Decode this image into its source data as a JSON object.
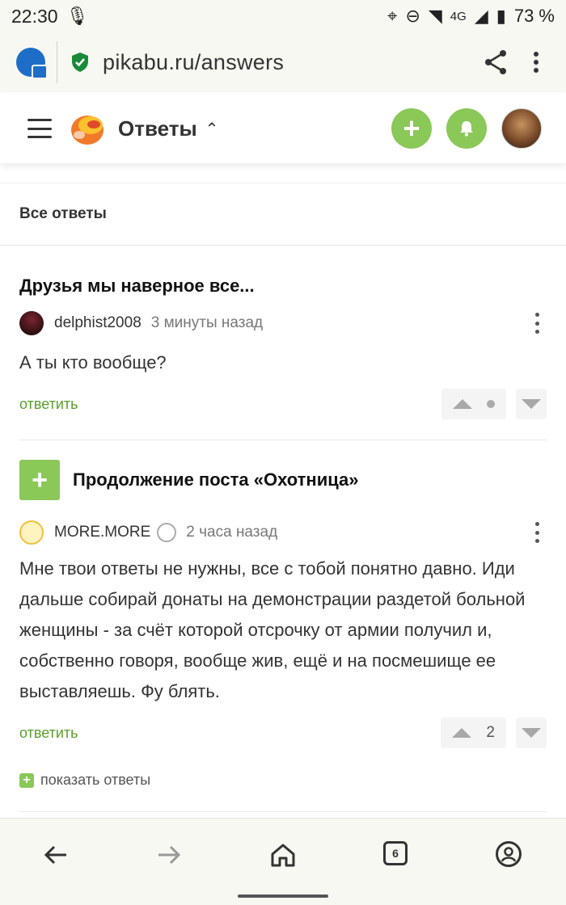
{
  "status_bar": {
    "time": "22:30",
    "network": "4G",
    "battery": "73 %"
  },
  "browser": {
    "url": "pikabu.ru/answers"
  },
  "header": {
    "title": "Ответы"
  },
  "section": {
    "title": "Все ответы"
  },
  "comments": [
    {
      "post_title": "Друзья мы наверное все...",
      "author": "delphist2008",
      "time": "3 минуты назад",
      "text": "А ты кто вообще?",
      "reply_label": "ответить",
      "rating": ""
    },
    {
      "post_title": "Продолжение поста «Охотница»",
      "author": "MORE.MORE",
      "time": "2 часа назад",
      "text": "Мне твои ответы не нужны, все с тобой понятно давно. Иди дальше собирай донаты на демонстрации раздетой больной женщины - за счёт которой отсрочку от армии получил и, собственно говоря, вообще жив, ещё и на посмешище ее выставляешь. Фу блять.",
      "reply_label": "ответить",
      "rating": "2",
      "show_replies_label": "показать ответы"
    }
  ],
  "bottom_nav": {
    "tabs_count": "6"
  },
  "colors": {
    "accent_green": "#8ac858",
    "link_green": "#5a9e2a",
    "shield_green": "#1a8a3a"
  }
}
